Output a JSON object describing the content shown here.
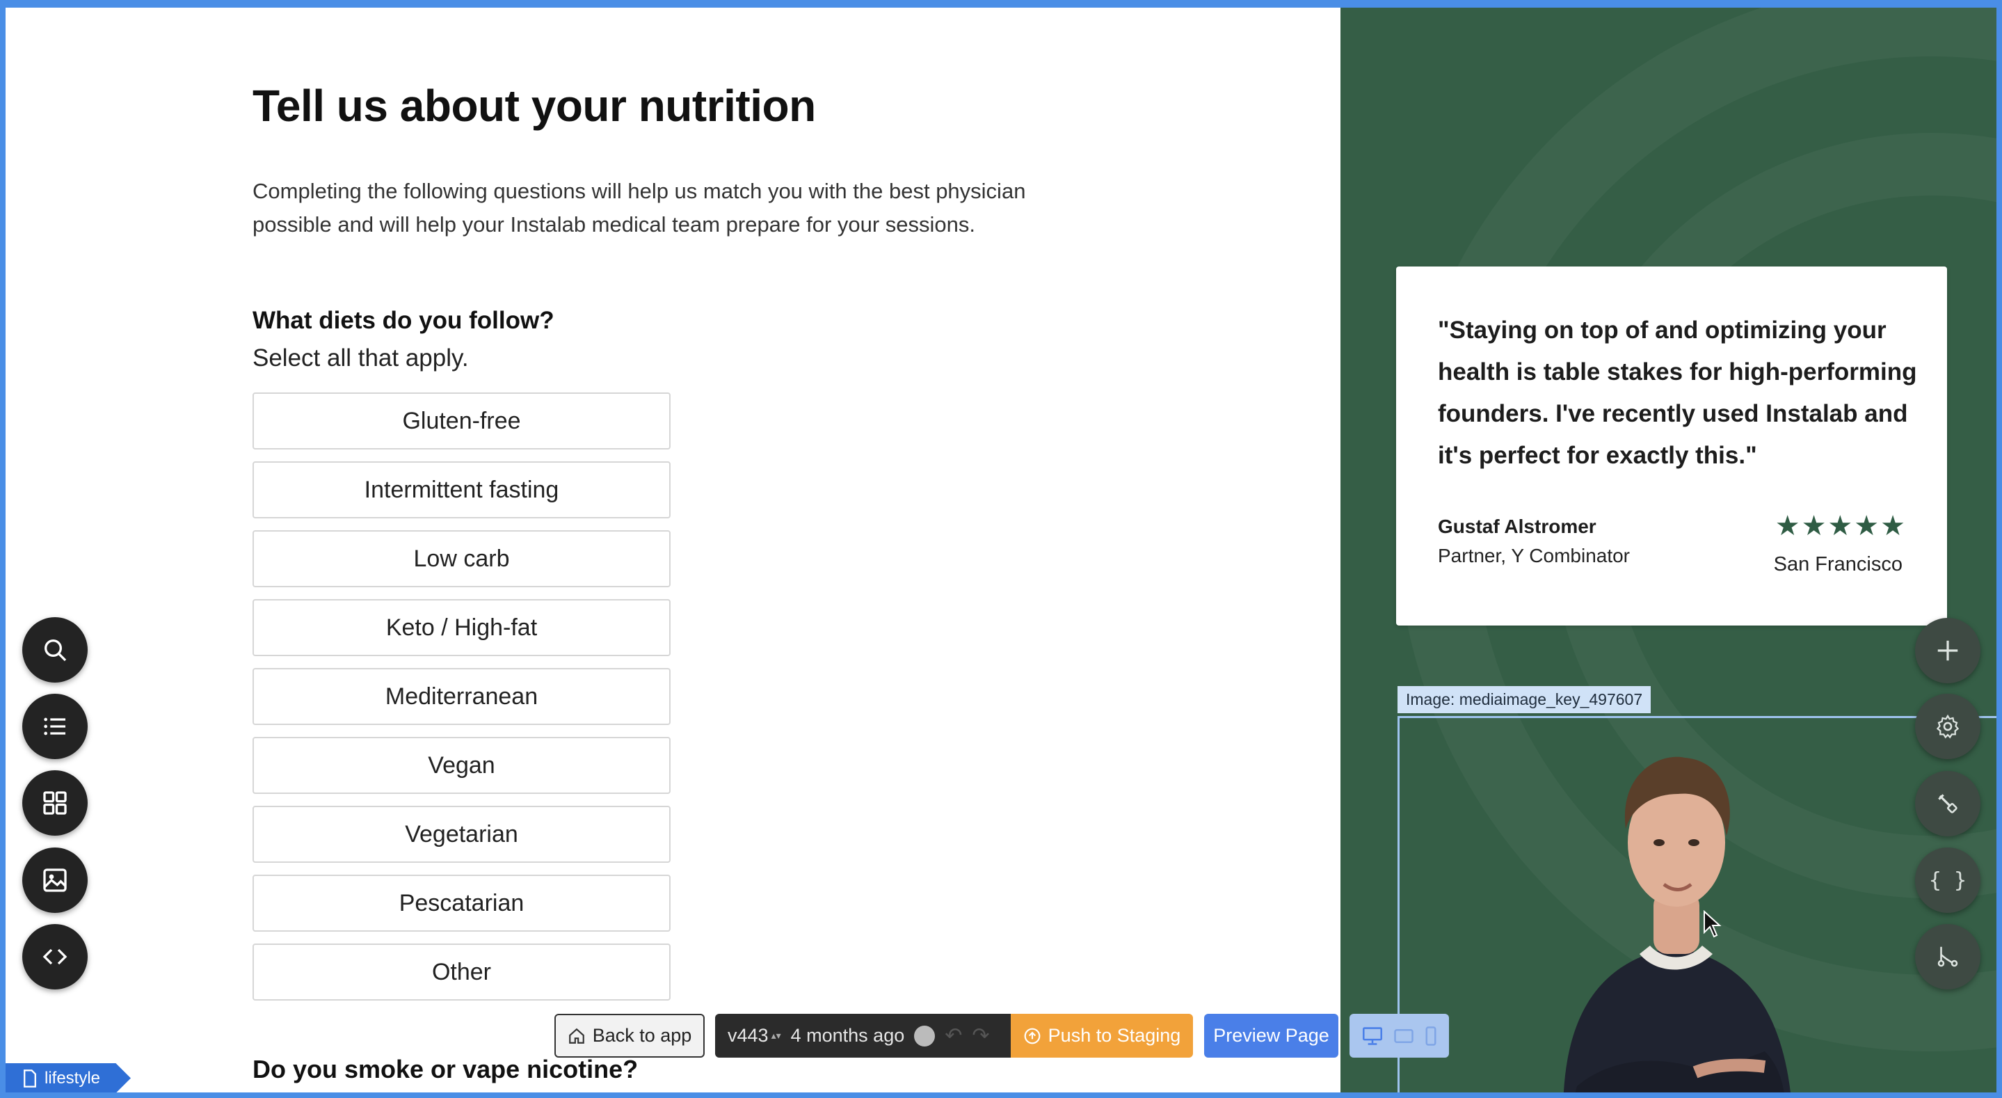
{
  "page": {
    "title": "Tell us about your nutrition",
    "intro": "Completing the following questions will help us match you with the best physician possible and will help your Instalab medical team prepare for your sessions.",
    "question1": {
      "title": "What diets do you follow?",
      "subtitle": "Select all that apply.",
      "options": [
        "Gluten-free",
        "Intermittent fasting",
        "Low carb",
        "Keto / High-fat",
        "Mediterranean",
        "Vegan",
        "Vegetarian",
        "Pescatarian",
        "Other"
      ]
    },
    "question2": {
      "title": "Do you smoke or vape nicotine?"
    }
  },
  "testimonial": {
    "quote": "\"Staying on top of and optimizing your health is table stakes for high-performing founders. I've recently used Instalab and it's perfect for exactly this.\"",
    "author": "Gustaf Alstromer",
    "role": "Partner, Y Combinator",
    "stars": 5,
    "stars_text": "★★★★★",
    "location": "San Francisco",
    "image_label": "Image: mediaimage_key_497607"
  },
  "toolbar": {
    "back_label": "Back to app",
    "version": "v443",
    "updated": "4 months ago",
    "push_label": "Push to Staging",
    "preview_label": "Preview Page"
  },
  "page_tag": {
    "label": "lifestyle"
  },
  "colors": {
    "panel_bg": "#355e46",
    "accent_blue": "#4a7fe8",
    "push_orange": "#f2a23a",
    "star_green": "#2f5c44"
  },
  "icons": {
    "left_tools": [
      "search-icon",
      "list-icon",
      "grid-icon",
      "image-icon",
      "code-icon"
    ],
    "right_tools": [
      "plus-icon",
      "gear-icon",
      "brush-icon",
      "braces-icon",
      "git-branch-icon"
    ]
  }
}
